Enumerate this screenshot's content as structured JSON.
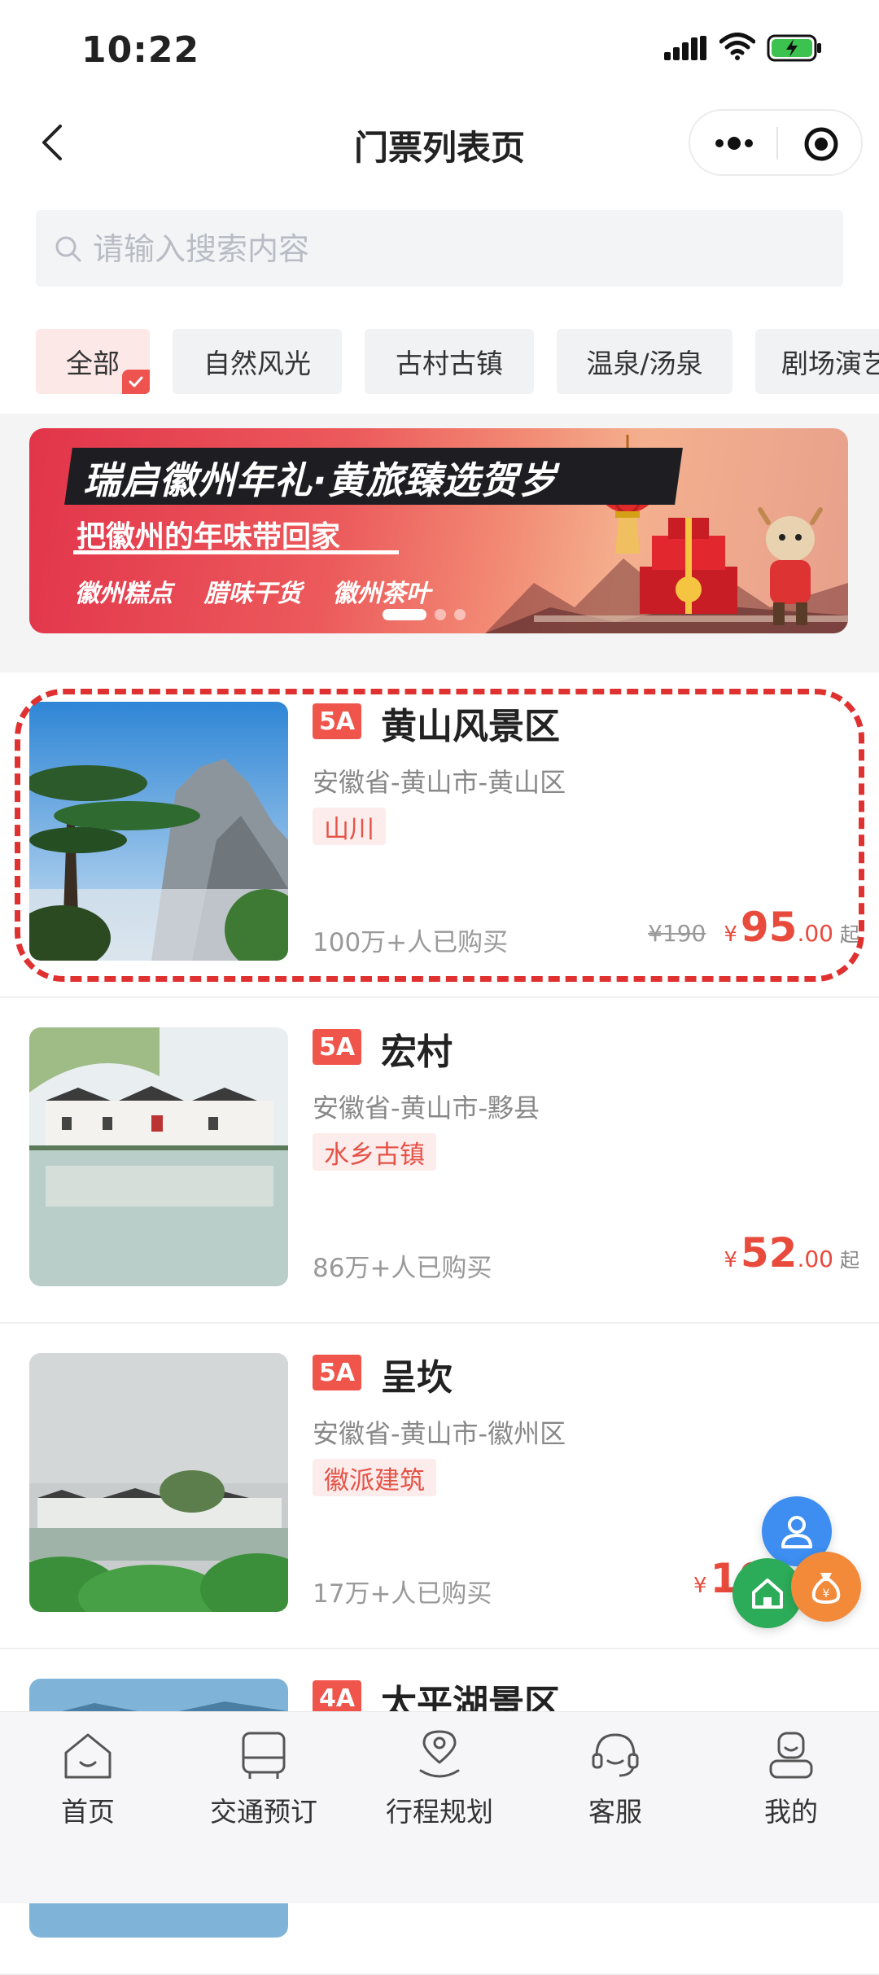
{
  "status_bar": {
    "time": "10:22"
  },
  "nav": {
    "title": "门票列表页"
  },
  "search": {
    "placeholder": "请输入搜索内容"
  },
  "categories": [
    {
      "label": "全部",
      "active": true
    },
    {
      "label": "自然风光",
      "active": false
    },
    {
      "label": "古村古镇",
      "active": false
    },
    {
      "label": "温泉/汤泉",
      "active": false
    },
    {
      "label": "剧场演艺",
      "active": false
    }
  ],
  "banner": {
    "title": "瑞启徽州年礼·黄旅臻选贺岁",
    "subtitle": "把徽州的年味带回家",
    "tags": [
      "徽州糕点",
      "腊味干货",
      "徽州茶叶"
    ]
  },
  "products": [
    {
      "grade": "5A",
      "name": "黄山风景区",
      "location": "安徽省-黄山市-黄山区",
      "tag": "山川",
      "sold": "100万+人已购买",
      "original_price": "¥190",
      "currency": "¥",
      "price_int": "95",
      "price_dec": ".00",
      "suffix": "起"
    },
    {
      "grade": "5A",
      "name": "宏村",
      "location": "安徽省-黄山市-黟县",
      "tag": "水乡古镇",
      "sold": "86万+人已购买",
      "original_price": "",
      "currency": "¥",
      "price_int": "52",
      "price_dec": ".00",
      "suffix": "起"
    },
    {
      "grade": "5A",
      "name": "呈坎",
      "location": "安徽省-黄山市-徽州区",
      "tag": "徽派建筑",
      "sold": "17万+人已购买",
      "original_price": "",
      "currency": "¥",
      "price_int": "10",
      "price_dec": "",
      "suffix": ""
    },
    {
      "grade": "4A",
      "name": "太平湖景区"
    }
  ],
  "tab_bar": [
    {
      "label": "首页",
      "icon": "home-icon"
    },
    {
      "label": "交通预订",
      "icon": "bus-icon"
    },
    {
      "label": "行程规划",
      "icon": "route-icon"
    },
    {
      "label": "客服",
      "icon": "headset-icon"
    },
    {
      "label": "我的",
      "icon": "profile-icon"
    }
  ],
  "colors": {
    "accent": "#e84a3c",
    "badge": "#f0554b",
    "highlight": "#e03131"
  }
}
